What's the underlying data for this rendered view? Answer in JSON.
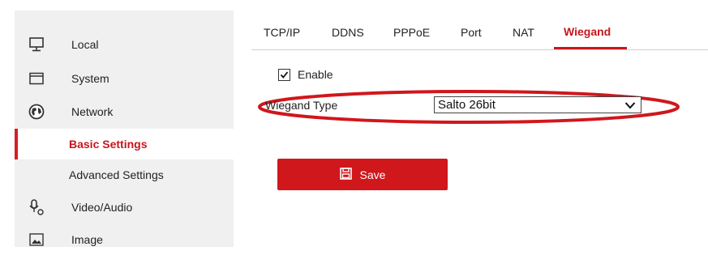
{
  "sidebar": {
    "items": [
      {
        "label": "Local",
        "icon": "monitor-icon"
      },
      {
        "label": "System",
        "icon": "window-icon"
      },
      {
        "label": "Network",
        "icon": "globe-icon"
      },
      {
        "label": "Basic Settings",
        "active": true
      },
      {
        "label": "Advanced Settings"
      },
      {
        "label": "Video/Audio",
        "icon": "camera-mic-icon"
      },
      {
        "label": "Image",
        "icon": "image-icon"
      }
    ]
  },
  "tabs": [
    {
      "label": "TCP/IP"
    },
    {
      "label": "DDNS"
    },
    {
      "label": "PPPoE"
    },
    {
      "label": "Port"
    },
    {
      "label": "NAT"
    },
    {
      "label": "Wiegand",
      "active": true
    }
  ],
  "form": {
    "enable_label": "Enable",
    "enable_checked": true,
    "wiegand_type_label": "Wiegand Type",
    "wiegand_type_value": "Salto 26bit",
    "save_label": "Save"
  },
  "colors": {
    "accent": "#c8161d",
    "button": "#d0171c",
    "sidebar_bg": "#f0f0f0",
    "highlight_oval": "#d0171c"
  }
}
